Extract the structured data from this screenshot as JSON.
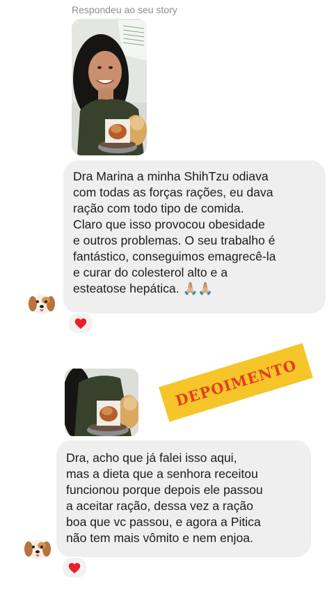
{
  "story_reply_label": "Respondeu ao seu story",
  "messages": [
    {
      "lines": [
        "Dra Marina a minha ShihTzu odiava",
        "com todas as forças rações, eu dava",
        "ração com todo tipo de comida.",
        "Claro que isso provocou obesidade",
        "e outros problemas. O seu trabalho é",
        "fantástico, conseguimos emagrecê-la",
        "e curar do colesterol alto e a",
        "esteatose hepática. 🙏🏼🙏🏼"
      ],
      "reaction": "heart"
    },
    {
      "lines": [
        "Dra, acho que já falei isso aqui,",
        "mas a dieta que a senhora receitou",
        "funcionou porque depois ele passou",
        "a aceitar ração, dessa vez a ração",
        "boa que vc passou, e agora a Pitica",
        "não tem mais vômito e nem enjoa."
      ],
      "reaction": "heart"
    }
  ],
  "stamp_text": "DEPOIMENTO",
  "colors": {
    "bubble": "#efefef",
    "heart": "#e8202a",
    "stamp_bg": "#f5c52a",
    "stamp_text": "#e23e1e"
  },
  "icons": {
    "avatar": "dog-face-icon",
    "reaction": "heart-icon"
  }
}
